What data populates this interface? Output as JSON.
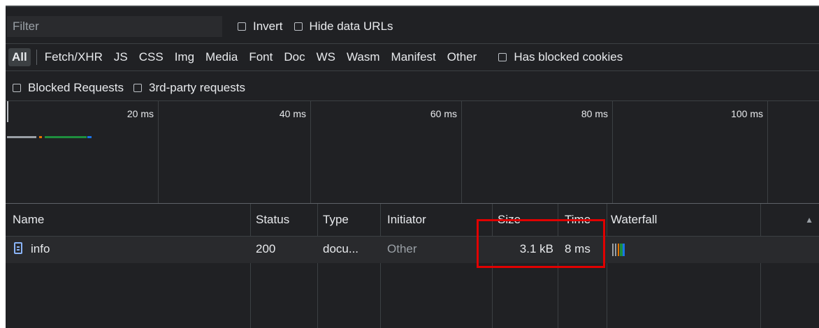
{
  "toolbar": {
    "filter_placeholder": "Filter",
    "invert_label": "Invert",
    "hide_data_urls_label": "Hide data URLs",
    "types": [
      "All",
      "Fetch/XHR",
      "JS",
      "CSS",
      "Img",
      "Media",
      "Font",
      "Doc",
      "WS",
      "Wasm",
      "Manifest",
      "Other"
    ],
    "active_type": "All",
    "has_blocked_cookies_label": "Has blocked cookies",
    "blocked_requests_label": "Blocked Requests",
    "third_party_label": "3rd-party requests"
  },
  "overview": {
    "ticks": [
      "20 ms",
      "40 ms",
      "60 ms",
      "80 ms",
      "100 ms"
    ]
  },
  "table": {
    "columns": {
      "name": "Name",
      "status": "Status",
      "type": "Type",
      "initiator": "Initiator",
      "size": "Size",
      "time": "Time",
      "waterfall": "Waterfall"
    },
    "rows": [
      {
        "name": "info",
        "status": "200",
        "type": "docu...",
        "initiator": "Other",
        "size": "3.1 kB",
        "time": "8 ms"
      }
    ]
  },
  "colors": {
    "panel_bg": "#202124",
    "highlight": "#e00000",
    "waterfall_green": "#1e8e3e",
    "waterfall_blue": "#1a73e8",
    "waterfall_orange": "#e37400"
  },
  "icons": {
    "document": "document-icon",
    "sort": "sort-triangle-icon"
  }
}
